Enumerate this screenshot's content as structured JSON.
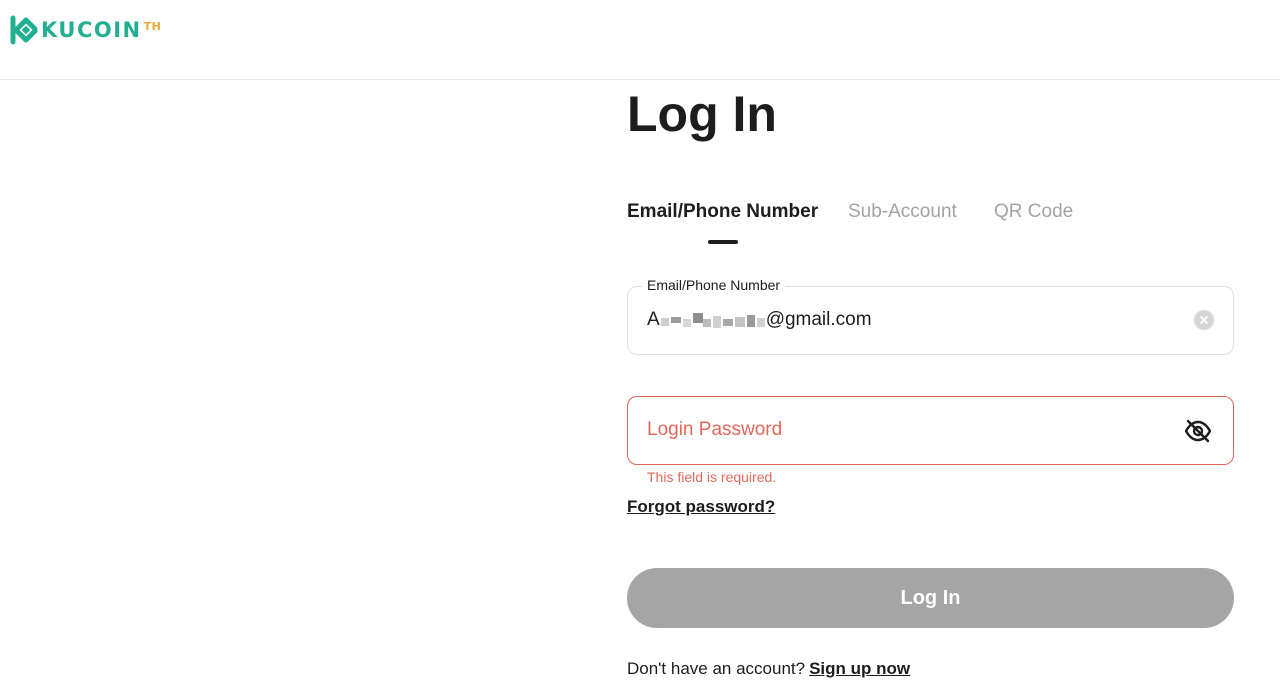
{
  "brand": {
    "name": "KUCOIN",
    "region": "TH",
    "accent": "#23af91",
    "region_color": "#e8a93a",
    "logo_icon": "kucoin-logo-icon"
  },
  "page": {
    "title": "Log In"
  },
  "tabs": [
    {
      "label": "Email/Phone Number",
      "active": true
    },
    {
      "label": "Sub-Account",
      "active": false
    },
    {
      "label": "QR Code",
      "active": false
    }
  ],
  "email_field": {
    "label": "Email/Phone Number",
    "value_start": "A",
    "value_end": "@gmail.com",
    "value_note_icon": "pixelated-redaction",
    "clear_icon": "clear-icon"
  },
  "password_field": {
    "placeholder": "Login Password",
    "toggle_icon": "eye-off-icon",
    "error": "This field is required.",
    "error_color": "#e2685c"
  },
  "links": {
    "forgot": "Forgot password?"
  },
  "submit": {
    "label": "Log In",
    "state": "disabled",
    "color": "#a5a5a5"
  },
  "signup": {
    "prompt": "Don't have an account?",
    "link": "Sign up now"
  }
}
